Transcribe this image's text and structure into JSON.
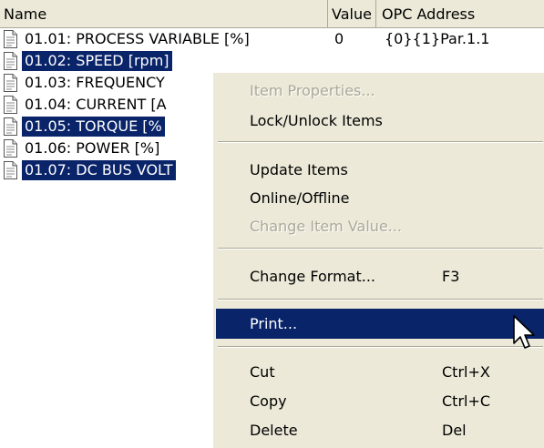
{
  "columns": {
    "name": "Name",
    "value": "Value",
    "opc_address": "OPC Address"
  },
  "rows": [
    {
      "name": "01.01: PROCESS VARIABLE [%]",
      "value": "0",
      "opc": "{0}{1}Par.1.1",
      "selected": false
    },
    {
      "name": "01.02: SPEED [rpm]",
      "value": "",
      "opc": "",
      "selected": true
    },
    {
      "name": "01.03: FREQUENCY",
      "value": "",
      "opc": "",
      "selected": false
    },
    {
      "name": "01.04: CURRENT [A",
      "value": "",
      "opc": "",
      "selected": false
    },
    {
      "name": "01.05: TORQUE [%",
      "value": "",
      "opc": "",
      "selected": true
    },
    {
      "name": "01.06: POWER [%]",
      "value": "",
      "opc": "",
      "selected": false
    },
    {
      "name": "01.07: DC BUS VOLT",
      "value": "",
      "opc": "",
      "selected": true
    }
  ],
  "context_menu": {
    "items": [
      {
        "label": "Item Properties...",
        "shortcut": "",
        "disabled": true
      },
      {
        "label": "Lock/Unlock Items",
        "shortcut": "",
        "disabled": false
      },
      {
        "label": "Update Items",
        "shortcut": "",
        "disabled": false
      },
      {
        "label": "Online/Offline",
        "shortcut": "",
        "disabled": false
      },
      {
        "label": "Change Item Value...",
        "shortcut": "",
        "disabled": true
      },
      {
        "label": "Change Format...",
        "shortcut": "F3",
        "disabled": false
      },
      {
        "label": "Print...",
        "shortcut": "",
        "disabled": false,
        "highlighted": true
      },
      {
        "label": "Cut",
        "shortcut": "Ctrl+X",
        "disabled": false
      },
      {
        "label": "Copy",
        "shortcut": "Ctrl+C",
        "disabled": false
      },
      {
        "label": "Delete",
        "shortcut": "Del",
        "disabled": false
      }
    ]
  },
  "icons": {
    "row_icon": "document-icon",
    "cursor": "mouse-pointer-icon"
  },
  "colors": {
    "selection": "#0a246a",
    "menu_bg": "#ece9d8",
    "disabled_text": "#aca899"
  }
}
